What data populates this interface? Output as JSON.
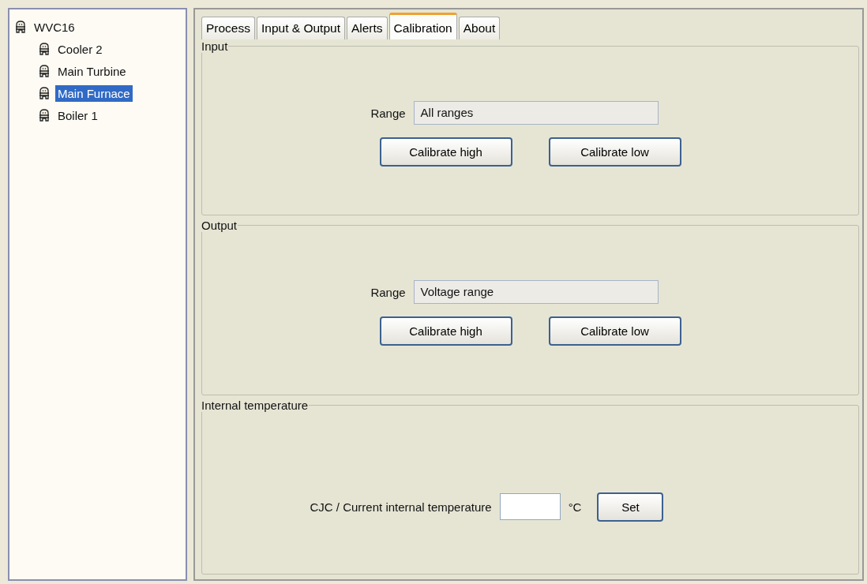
{
  "tree": {
    "label": "WVC16",
    "selected": false,
    "children": [
      {
        "label": "Cooler 2",
        "selected": false
      },
      {
        "label": "Main Turbine",
        "selected": false
      },
      {
        "label": "Main Furnace",
        "selected": true
      },
      {
        "label": "Boiler 1",
        "selected": false
      }
    ]
  },
  "tabs": [
    {
      "label": "Process",
      "selected": false
    },
    {
      "label": "Input & Output",
      "selected": false
    },
    {
      "label": "Alerts",
      "selected": false
    },
    {
      "label": "Calibration",
      "selected": true
    },
    {
      "label": "About",
      "selected": false
    }
  ],
  "groups": [
    {
      "kind": "range",
      "title": "Input",
      "range_label": "Range",
      "range_value": "All ranges",
      "buttons": [
        "Calibrate high",
        "Calibrate low"
      ]
    },
    {
      "kind": "range",
      "title": "Output",
      "range_label": "Range",
      "range_value": "Voltage range",
      "buttons": [
        "Calibrate high",
        "Calibrate low"
      ]
    },
    {
      "kind": "temperature",
      "title": "Internal temperature",
      "field_label": "CJC / Current internal temperature",
      "unit": "°C",
      "button": "Set"
    }
  ]
}
